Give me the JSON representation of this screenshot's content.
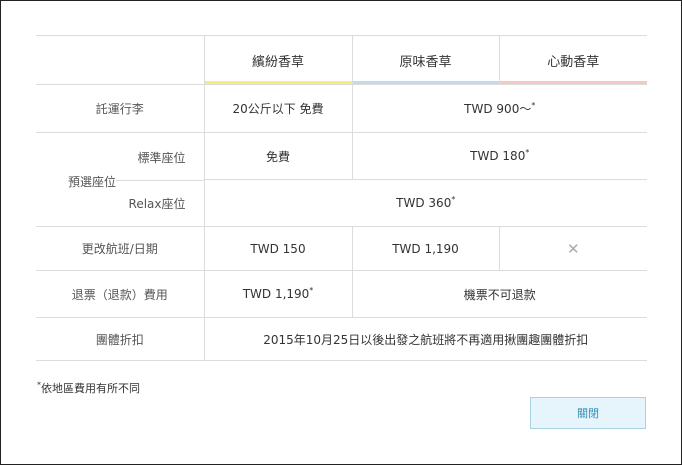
{
  "columns": {
    "col1": "繽紛香草",
    "col2": "原味香草",
    "col3": "心動香草",
    "col1_color": "#f3ee7c",
    "col2_color": "#bfdcec",
    "col3_color": "#f6c8c4"
  },
  "rows": {
    "baggage": {
      "label": "託運行李",
      "col1": "20公斤以下 免費",
      "span23": "TWD 900～",
      "span23_mark": "*"
    },
    "seat_group_label": "預選座位",
    "seat_standard": {
      "label": "標準座位",
      "col1": "免費",
      "span23": "TWD 180",
      "span23_mark": "*"
    },
    "seat_relax": {
      "label": "Relax座位",
      "span123": "TWD 360",
      "span123_mark": "*"
    },
    "change": {
      "label": "更改航班/日期",
      "col1": "TWD 150",
      "col2": "TWD 1,190",
      "col3_icon": "close-x-icon"
    },
    "refund": {
      "label": "退票（退款）費用",
      "col1": "TWD 1,190",
      "col1_mark": "*",
      "span23": "機票不可退款"
    },
    "group": {
      "label": "團體折扣",
      "span123": "2015年10月25日以後出發之航班將不再適用揪團趣團體折扣"
    }
  },
  "footnote": {
    "mark": "*",
    "text": "依地區費用有所不同"
  },
  "close_button": {
    "label": "關閉"
  }
}
